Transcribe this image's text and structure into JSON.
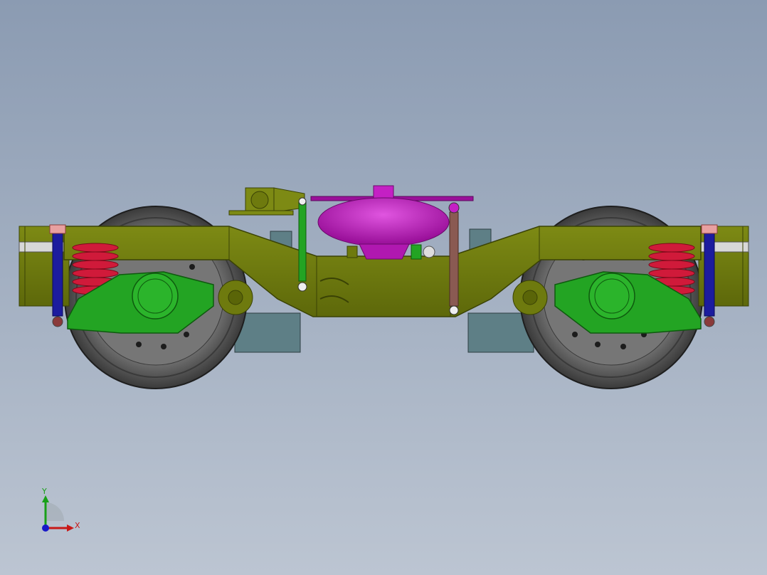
{
  "viewport": {
    "background_top": "#8b9bb2",
    "background_bottom": "#bcc5d2"
  },
  "model": {
    "colors": {
      "frame": "#6e7a0e",
      "frame_dark": "#3a4205",
      "axle_box": "#23a423",
      "spring": "#d01a3a",
      "spring_inner": "#8a1ac0",
      "damper": "#1c1ca6",
      "air_spring": "#c420c4",
      "wheel": "#5a5a5a",
      "wheel_dark": "#2e2e2e",
      "block": "#5e7f86",
      "rod": "#8a5a52"
    }
  },
  "triad": {
    "x_label": "X",
    "y_label": "Y",
    "x_color": "#c81818",
    "y_color": "#18a018",
    "z_color": "#1818c8"
  }
}
